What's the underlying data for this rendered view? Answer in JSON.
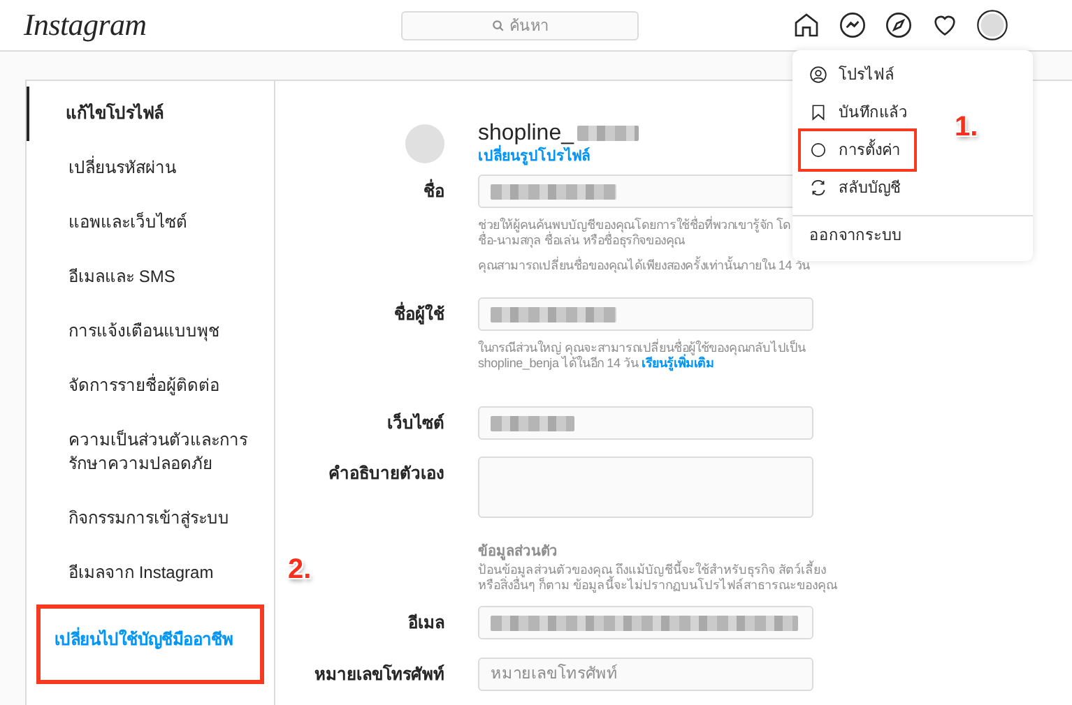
{
  "header": {
    "logo": "Instagram",
    "search": {
      "placeholder": "ค้นหา"
    }
  },
  "sidebar": {
    "items": [
      {
        "label": "แก้ไขโปรไฟล์",
        "selected": true,
        "kind": "plain",
        "outlined": false
      },
      {
        "label": "เปลี่ยนรหัสผ่าน",
        "selected": false,
        "kind": "plain",
        "outlined": false
      },
      {
        "label": "แอพและเว็บไซต์",
        "selected": false,
        "kind": "plain",
        "outlined": false
      },
      {
        "label": "อีเมลและ SMS",
        "selected": false,
        "kind": "plain",
        "outlined": false
      },
      {
        "label": "การแจ้งเตือนแบบพุช",
        "selected": false,
        "kind": "plain",
        "outlined": false
      },
      {
        "label": "จัดการรายชื่อผู้ติดต่อ",
        "selected": false,
        "kind": "plain",
        "outlined": false
      },
      {
        "label": "ความเป็นส่วนตัวและการรักษาความปลอดภัย",
        "selected": false,
        "kind": "plain",
        "outlined": false
      },
      {
        "label": "กิจกรรมการเข้าสู่ระบบ",
        "selected": false,
        "kind": "plain",
        "outlined": false
      },
      {
        "label": "อีเมลจาก Instagram",
        "selected": false,
        "kind": "plain",
        "outlined": false
      },
      {
        "label": "เปลี่ยนไปใช้บัญชีมืออาชีพ",
        "selected": false,
        "kind": "action",
        "outlined": true
      }
    ]
  },
  "profile": {
    "username": "shopline_",
    "username_redacted": true,
    "change_photo": "เปลี่ยนรูปโปรไฟล์"
  },
  "fields": [
    {
      "label": "ชื่อ",
      "kind": "input",
      "redacted": true,
      "help": [
        {
          "lines": [
            "ช่วยให้ผู้คนค้นพบบัญชีของคุณโดยการใช้ชื่อที่พวกเขารู้จัก โด",
            "ชื่อ-นามสกุล ชื่อเล่น หรือชื่อธุรกิจของคุณ"
          ]
        },
        {
          "lines": [
            "คุณสามารถเปลี่ยนชื่อของคุณได้เพียงสองครั้งเท่านั้นภายใน 14 วัน"
          ]
        }
      ]
    },
    {
      "label": "ชื่อผู้ใช้",
      "kind": "input",
      "redacted": true,
      "help": [
        {
          "lines": [
            "ในกรณีส่วนใหญ่ คุณจะสามารถเปลี่ยนชื่อผู้ใช้ของคุณกลับไปเป็น",
            "shopline_benja ได้ในอีก 14 วัน"
          ],
          "link": "เรียนรู้เพิ่มเติม"
        }
      ]
    },
    {
      "label": "เว็บไซต์",
      "kind": "input",
      "redacted": true
    },
    {
      "label": "คำอธิบายตัวเอง",
      "kind": "textarea"
    },
    {
      "kind": "section",
      "title": "ข้อมูลส่วนตัว",
      "description": "ป้อนข้อมูลส่วนตัวของคุณ ถึงแม้บัญชีนี้จะใช้สำหรับธุรกิจ สัตว์เลี้ยง หรือสิ่งอื่นๆ ก็ตาม ข้อมูลนี้จะไม่ปรากฏบนโปรไฟล์สาธารณะของคุณ"
    },
    {
      "label": "อีเมล",
      "kind": "input",
      "redacted": true
    },
    {
      "label": "หมายเลขโทรศัพท์",
      "kind": "input",
      "placeholder": "หมายเลขโทรศัพท์"
    }
  ],
  "menu": {
    "items": [
      {
        "label": "โปรไฟล์",
        "kind": "profile",
        "outlined": false
      },
      {
        "label": "บันทึกแล้ว",
        "kind": "saved",
        "outlined": false
      },
      {
        "label": "การตั้งค่า",
        "kind": "settings",
        "outlined": true
      },
      {
        "label": "สลับบัญชี",
        "kind": "switch",
        "outlined": false
      }
    ],
    "logout": "ออกจากระบบ"
  },
  "annotations": [
    {
      "label": "1."
    },
    {
      "label": "2."
    }
  ]
}
